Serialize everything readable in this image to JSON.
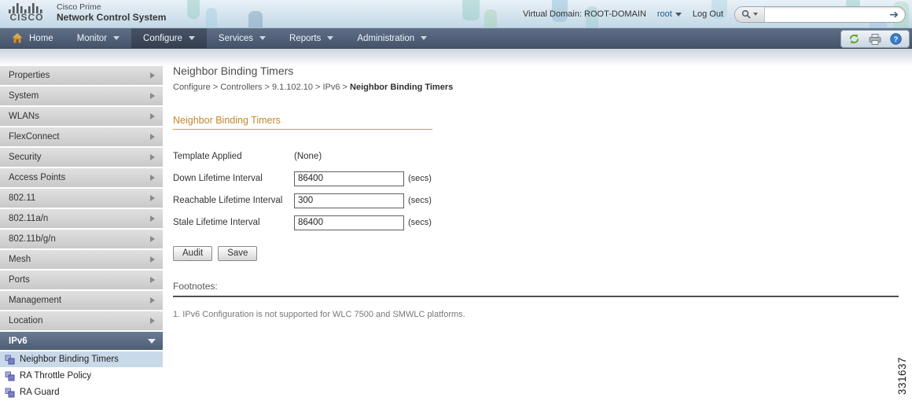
{
  "header": {
    "logo_text": "CISCO",
    "brand_line1": "Cisco Prime",
    "brand_line2": "Network Control System",
    "virtual_domain": "Virtual Domain: ROOT-DOMAIN",
    "user": "root",
    "logout_label": "Log Out",
    "search": {
      "value": "",
      "placeholder": ""
    }
  },
  "nav": {
    "items": [
      {
        "label": "Home"
      },
      {
        "label": "Monitor"
      },
      {
        "label": "Configure"
      },
      {
        "label": "Services"
      },
      {
        "label": "Reports"
      },
      {
        "label": "Administration"
      }
    ],
    "active_item": "Configure"
  },
  "sidebar": {
    "items": [
      {
        "label": "Properties"
      },
      {
        "label": "System"
      },
      {
        "label": "WLANs"
      },
      {
        "label": "FlexConnect"
      },
      {
        "label": "Security"
      },
      {
        "label": "Access Points"
      },
      {
        "label": "802.11"
      },
      {
        "label": "802.11a/n"
      },
      {
        "label": "802.11b/g/n"
      },
      {
        "label": "Mesh"
      },
      {
        "label": "Ports"
      },
      {
        "label": "Management"
      },
      {
        "label": "Location"
      }
    ],
    "expanded_section": {
      "label": "IPv6"
    },
    "sub_items": [
      {
        "label": "Neighbor Binding Timers",
        "selected": true
      },
      {
        "label": "RA Throttle Policy",
        "selected": false
      },
      {
        "label": "RA Guard",
        "selected": false
      }
    ]
  },
  "main": {
    "page_title": "Neighbor Binding Timers",
    "breadcrumb": {
      "path": "Configure > Controllers > 9.1.102.10 > IPv6 > ",
      "current": "Neighbor Binding Timers"
    },
    "section_title": "Neighbor Binding Timers",
    "form": {
      "template_label": "Template Applied",
      "template_value": "(None)",
      "fields": [
        {
          "label": "Down Lifetime Interval",
          "value": "86400",
          "unit": "(secs)"
        },
        {
          "label": "Reachable Lifetime Interval",
          "value": "300",
          "unit": "(secs)"
        },
        {
          "label": "Stale Lifetime Interval",
          "value": "86400",
          "unit": "(secs)"
        }
      ],
      "audit_label": "Audit",
      "save_label": "Save"
    },
    "footnotes": {
      "title": "Footnotes:",
      "item1": "1. IPv6 Configuration is not supported for WLC 7500 and SMWLC platforms."
    }
  },
  "figure_number": "331637",
  "colors": {
    "accent_orange": "#c4872b",
    "nav_bar": "#4e5d76",
    "banner_blue": "#c3d8e7",
    "selected_subitem": "#c8d9e9",
    "sidebar_item": "#d4d4d4"
  }
}
